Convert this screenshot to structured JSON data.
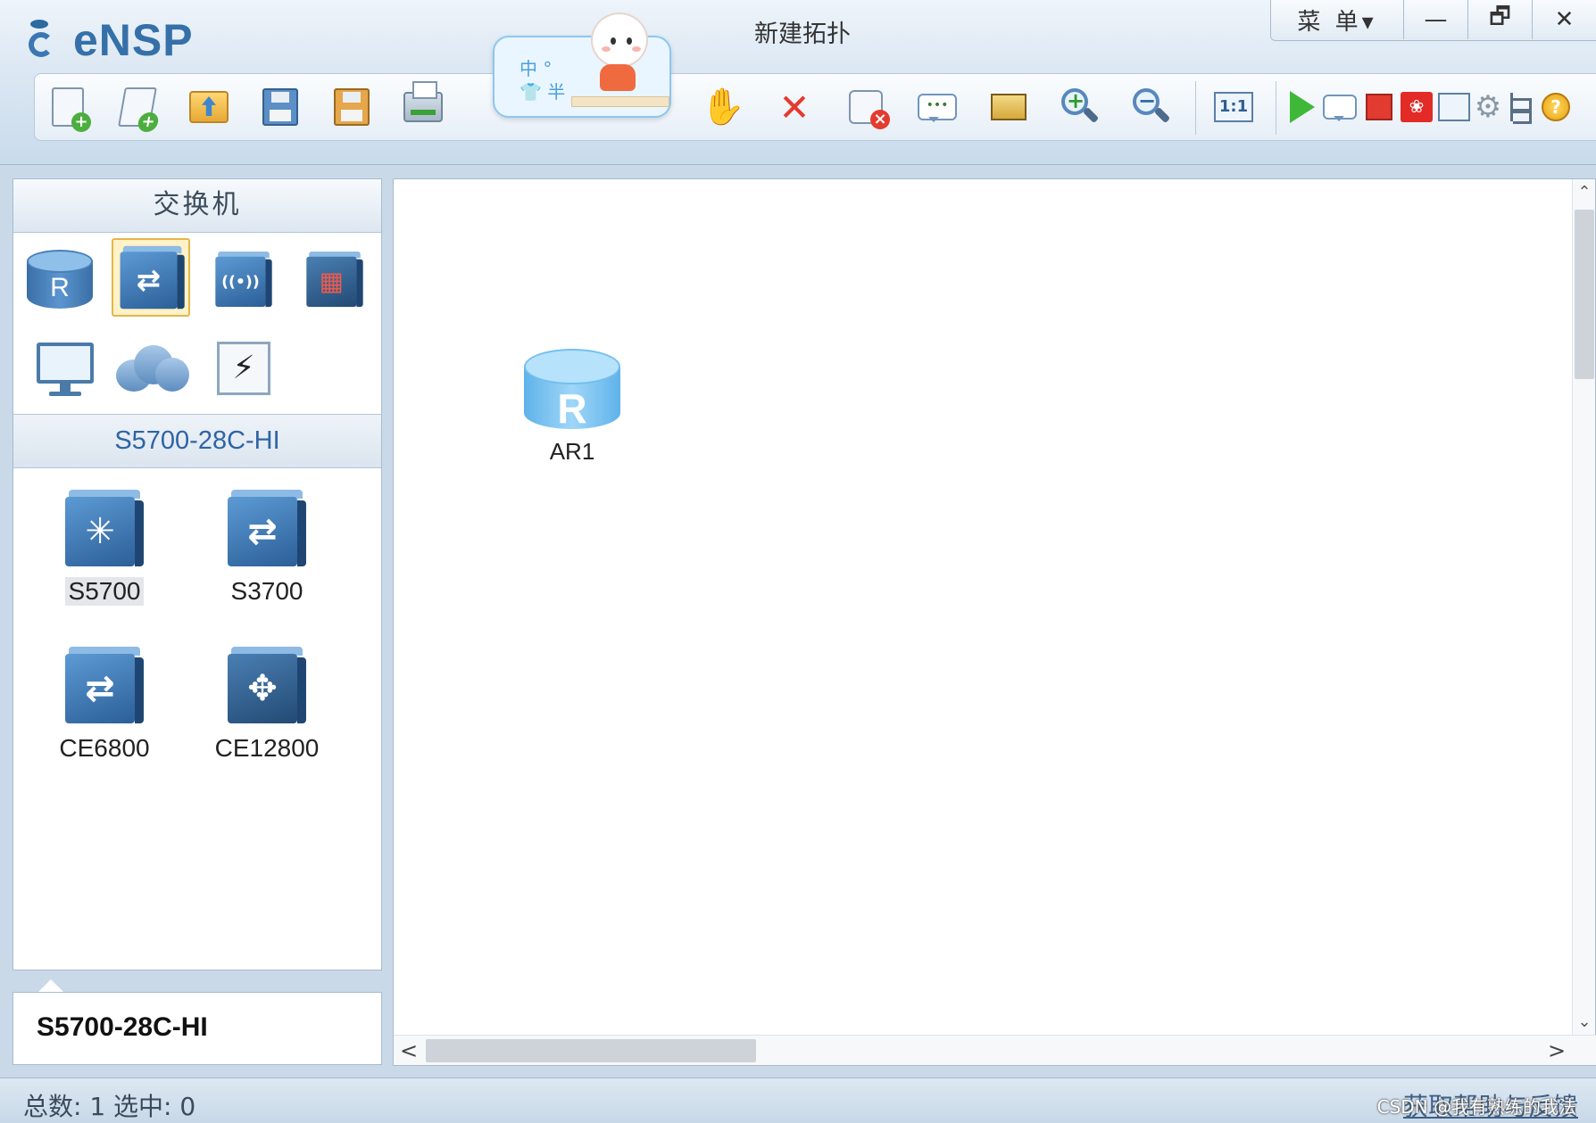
{
  "app": {
    "logo_text": "eNSP",
    "window_title": "新建拓扑"
  },
  "window_controls": {
    "menu_label": "菜 单▾",
    "minimize": "—",
    "restore": "🗗",
    "close": "✕"
  },
  "sticker": {
    "line1": "中 °",
    "line2": "👕 半"
  },
  "toolbar": {
    "bubble_text": "•••",
    "zoom_in_symbol": "+",
    "zoom_out_symbol": "−",
    "fit_label": "1:1",
    "huawei_label": "❀",
    "help_label": "?",
    "gear_glyph": "⚙",
    "hand_glyph": "✋",
    "delete_glyph": "✕"
  },
  "left_panel": {
    "header": "交换机",
    "category_glyphs": {
      "router": "R",
      "switch": "⇄",
      "wireless": "((•))",
      "firewall": "▦",
      "lightning": "⚡"
    },
    "subheader": "S5700-28C-HI",
    "devices": [
      {
        "label": "S5700",
        "glyph": "✳"
      },
      {
        "label": "S3700",
        "glyph": "⇄"
      },
      {
        "label": "CE6800",
        "glyph": "⇄"
      },
      {
        "label": "CE12800",
        "glyph": "✥"
      }
    ],
    "description_title": "S5700-28C-HI"
  },
  "canvas": {
    "nodes": [
      {
        "label": "AR1",
        "glyph": "R"
      }
    ],
    "scroll_up": "⌃",
    "scroll_down": "⌄",
    "scroll_left": "<",
    "scroll_right": ">"
  },
  "status": {
    "text": "总数: 1  选中: 0",
    "help_link": "获取帮助与反馈",
    "watermark": "CSDN @我有熟练的我法"
  }
}
